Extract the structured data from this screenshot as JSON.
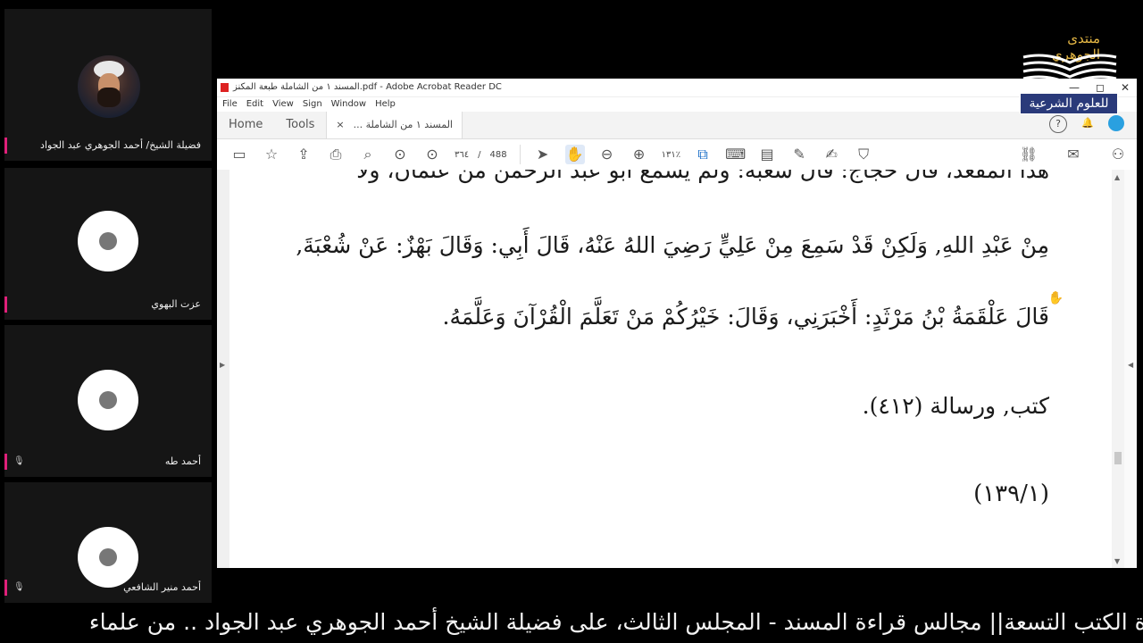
{
  "participants": [
    {
      "name": "فضيلة الشيخ/ أحمد الجوهري عبد الجواد",
      "muted": false,
      "has_photo": true
    },
    {
      "name": "عزت البهوي",
      "muted": false,
      "has_photo": false
    },
    {
      "name": "أحمد طه",
      "muted": true,
      "has_photo": false
    },
    {
      "name": "أحمد منير الشافعي",
      "muted": true,
      "has_photo": false
    }
  ],
  "acrobat": {
    "window_title": "المسند ١ من الشاملة طبعة المكنز.pdf - Adobe Acrobat Reader DC",
    "menu": [
      "File",
      "Edit",
      "View",
      "Sign",
      "Window",
      "Help"
    ],
    "tabs": {
      "home": "Home",
      "tools": "Tools",
      "document": "المسند ١ من الشاملة ..."
    },
    "page_current": "٣٦٤",
    "page_total": "488",
    "page_separator": "/",
    "zoom": "١٣١٪",
    "help_icon": "?",
    "window_controls": {
      "minimize": "—",
      "maximize": "◻",
      "close": "✕"
    },
    "tab_close": "×",
    "icons": [
      "save-icon",
      "bookmark-star-icon",
      "upload-icon",
      "print-icon",
      "search-icon",
      "prev-page-icon",
      "next-page-icon",
      "select-arrow-icon",
      "hand-icon",
      "zoom-out-icon",
      "zoom-in-icon",
      "fit-page-icon",
      "keyboard-icon",
      "comment-icon",
      "highlight-pen-icon",
      "sign-icon",
      "stamp-icon",
      "share-link-icon",
      "email-icon",
      "add-user-icon"
    ],
    "text_lines": [
      "هذا المقعد، قال حجاج: قال شعبة: ولم يسمع أبو عبد الرحمن من عثمان، ولا",
      "مِنْ عَبْدِ اللهِ, وَلَكِنْ قَدْ سَمِعَ مِنْ عَلِيٍّ رَضِيَ اللهُ عَنْهُ، قَالَ أَبِي: وَقَالَ بَهْزٌ: عَنْ شُعْبَةَ,",
      "قَالَ عَلْقَمَةُ بْنُ مَرْثَدٍ: أَخْبَرَنِي، وَقَالَ: خَيْرُكُمْ مَنْ تَعَلَّمَ الْقُرْآنَ وَعَلَّمَهُ.",
      "كتب, ورسالة (٤١٢).",
      "(١٣٩/١)"
    ]
  },
  "logo": {
    "top": "منتدى الجوهري",
    "bottom": "للعلوم الشرعية"
  },
  "ticker": "ـوة الكتب التسعة|| مجالس قراءة المسند - المجلس الثالث، على فضيلة الشيخ أحمد الجوهري عبد الجواد .. من علماء",
  "colors": {
    "accent_bar": "#e0207a",
    "logo_plate": "#2a3a7a",
    "logo_gold": "#e6b845",
    "acrobat_blue": "#1c6fc8"
  }
}
